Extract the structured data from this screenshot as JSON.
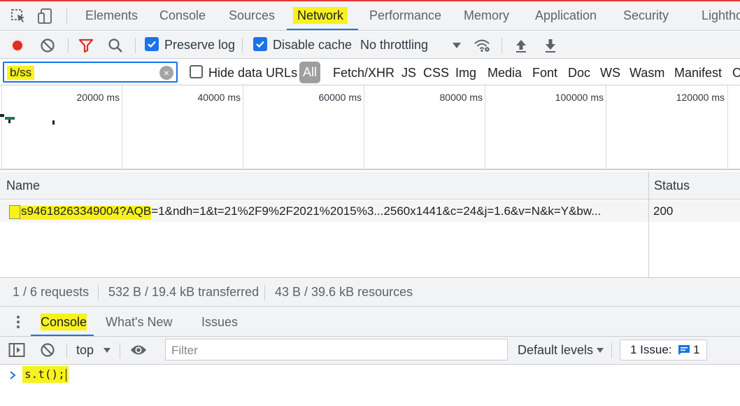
{
  "tabs": {
    "items": [
      "Elements",
      "Console",
      "Sources",
      "Network",
      "Performance",
      "Memory",
      "Application",
      "Security",
      "Lighthouse"
    ],
    "active": "Network"
  },
  "toolbar": {
    "preserve_log_label": "Preserve log",
    "preserve_log_checked": true,
    "disable_cache_label": "Disable cache",
    "disable_cache_checked": true,
    "throttling_value": "No throttling"
  },
  "filter": {
    "value": "b/ss",
    "hide_data_urls_label": "Hide data URLs",
    "types": [
      "All",
      "Fetch/XHR",
      "JS",
      "CSS",
      "Img",
      "Media",
      "Font",
      "Doc",
      "WS",
      "Wasm",
      "Manifest",
      "Other"
    ],
    "active_type": "All"
  },
  "overview": {
    "ticks": [
      "20000 ms",
      "40000 ms",
      "60000 ms",
      "80000 ms",
      "100000 ms",
      "120000 ms"
    ]
  },
  "table": {
    "columns": [
      "Name",
      "Status"
    ],
    "rows": [
      {
        "name": "s94618263349004?AQB=1&ndh=1&t=21%2F9%2F2021%2015%3...2560x1441&c=24&j=1.6&v=N&k=Y&bw...",
        "status": "200"
      }
    ]
  },
  "status_bar": {
    "requests": "1 / 6 requests",
    "transferred": "532 B / 19.4 kB transferred",
    "resources": "43 B / 39.6 kB resources"
  },
  "drawer": {
    "tabs": [
      "Console",
      "What's New",
      "Issues"
    ],
    "active": "Console"
  },
  "console": {
    "context": "top",
    "filter_placeholder": "Filter",
    "levels": "Default levels",
    "issues_label": "1 Issue:",
    "issues_count": "1",
    "prompt_text": "s.t();"
  },
  "colors": {
    "accent": "#1a73e8",
    "highlight": "#f7f21d",
    "record": "#d93025",
    "toolbar_bg": "#f1f3f4"
  }
}
